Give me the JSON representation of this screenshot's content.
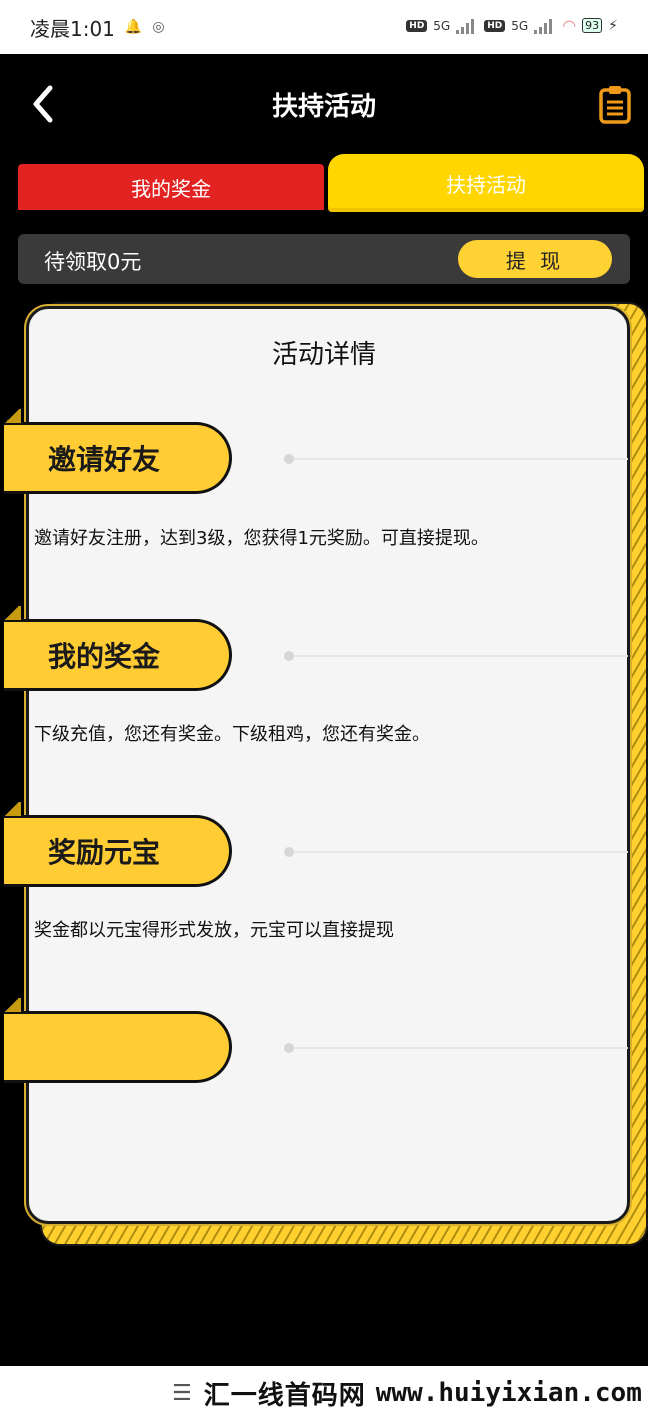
{
  "status": {
    "time": "凌晨1:01",
    "network_1": "5G",
    "network_2": "5G",
    "hd": "HD",
    "battery": "93"
  },
  "header": {
    "title": "扶持活动"
  },
  "tabs": {
    "mine_label": "我的奖金",
    "support_label": "扶持活动"
  },
  "pending": {
    "text": "待领取0元",
    "withdraw_label": "提 现"
  },
  "card": {
    "title": "活动详情",
    "sections": [
      {
        "label": "邀请好友",
        "desc": "邀请好友注册，达到3级，您获得1元奖励。可直接提现。"
      },
      {
        "label": "我的奖金",
        "desc": "下级充值，您还有奖金。下级租鸡，您还有奖金。"
      },
      {
        "label": "奖励元宝",
        "desc": "奖金都以元宝得形式发放，元宝可以直接提现"
      },
      {
        "label": "",
        "desc": ""
      }
    ]
  },
  "footer": {
    "watermark_cn": "汇一线首码网",
    "watermark_url": "www.huiyixian.com"
  },
  "colors": {
    "accent_yellow": "#ffd600",
    "tab_red": "#e32322",
    "icon_orange": "#f09a1a"
  }
}
